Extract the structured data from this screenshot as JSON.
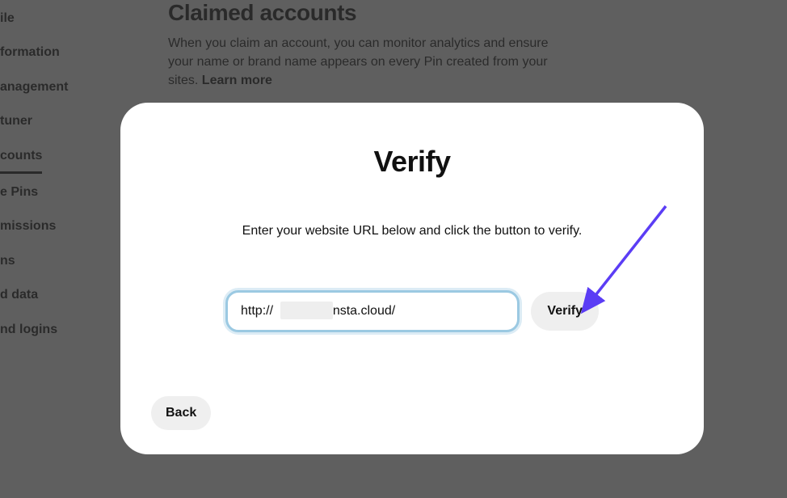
{
  "sidebar": {
    "items": [
      {
        "label": "ile"
      },
      {
        "label": "formation"
      },
      {
        "label": "anagement"
      },
      {
        "label": " tuner"
      },
      {
        "label": "counts",
        "active": true
      },
      {
        "label": "e Pins"
      },
      {
        "label": "missions"
      },
      {
        "label": "ns"
      },
      {
        "label": "d data"
      },
      {
        "label": "nd logins"
      }
    ]
  },
  "main": {
    "title": "Claimed accounts",
    "description": "When you claim an account, you can monitor analytics and ensure your name or brand name appears on every Pin created from your sites. ",
    "learn_more": "Learn more"
  },
  "modal": {
    "title": "Verify",
    "description": "Enter your website URL below and click the button to verify.",
    "url_value": "http://             .kinsta.cloud/",
    "verify_label": "Verify",
    "back_label": "Back"
  }
}
